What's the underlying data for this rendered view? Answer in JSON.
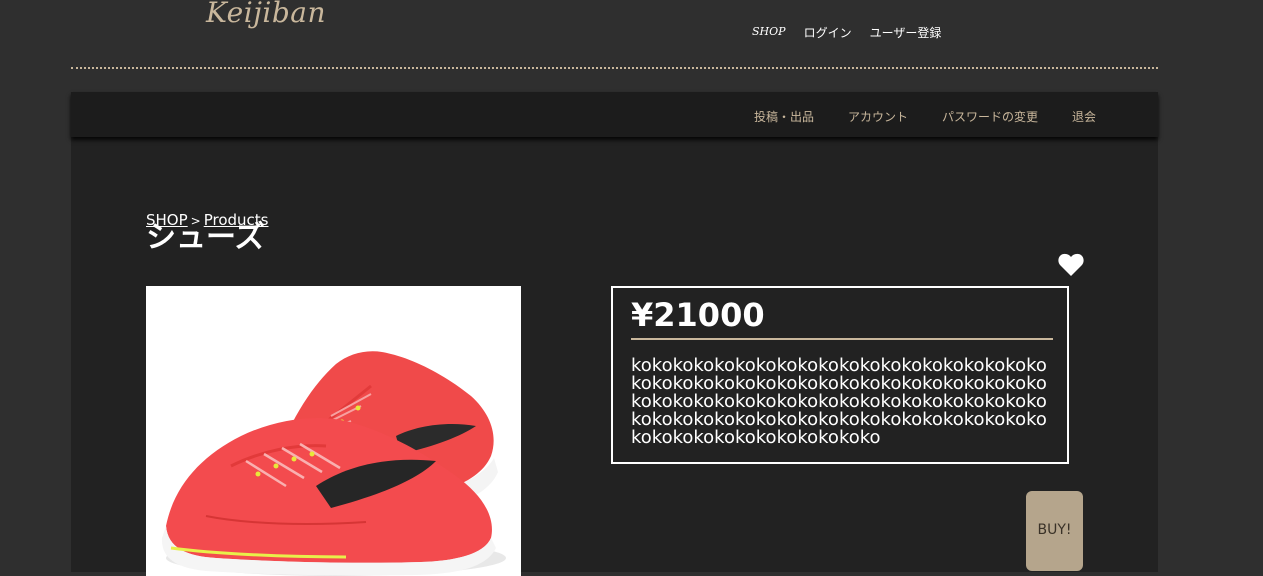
{
  "header": {
    "logo": "Keijiban",
    "nav": {
      "shop": "SHOP",
      "login": "ログイン",
      "register": "ユーザー登録"
    }
  },
  "subnav": {
    "items": [
      "投稿・出品",
      "アカウント",
      "パスワードの変更",
      "退会"
    ]
  },
  "breadcrumb": {
    "shop": "SHOP",
    "separator": ">",
    "products": "Products"
  },
  "product": {
    "title": "シューズ",
    "price": "¥21000",
    "description": "kokokokokokokokokokokokokokokokokokokokokokokokokokokokokokokokokokokokokokokokokokokokokokokokokokokokokokokokokokokokokokokokokokokokokokokokokokokokokokokokokokokokokokokokokokokoko",
    "buy_label": "BUY!",
    "image_subject": "red running shoes"
  },
  "icons": {
    "favorite": "heart-icon"
  },
  "colors": {
    "background": "#2f2f2f",
    "panel": "#222222",
    "subnav": "#1c1c1c",
    "accent": "#c9b79c",
    "buy_button": "#b5a58c",
    "text": "#ffffff"
  }
}
